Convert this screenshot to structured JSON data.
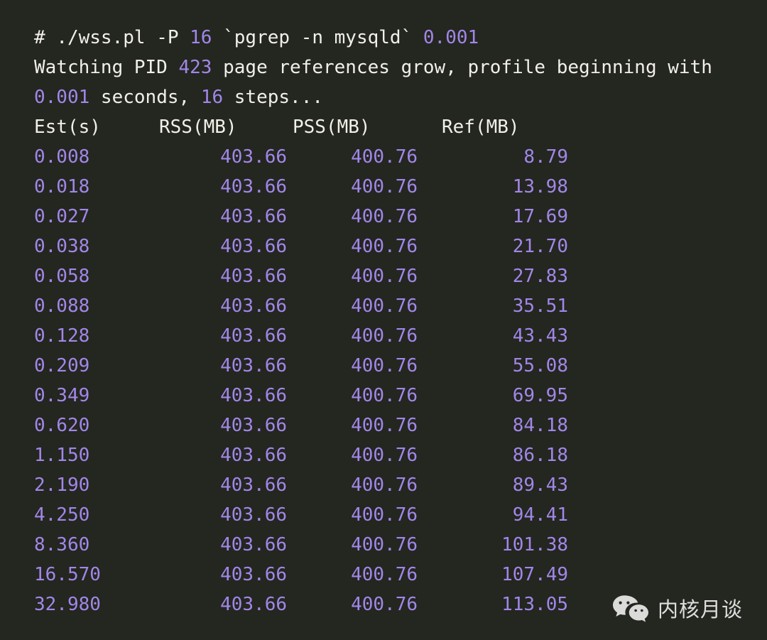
{
  "terminal": {
    "background_color": "#242620",
    "text_color": "#f1f0e8",
    "number_color": "#a187e8",
    "command_line": {
      "prompt": "# ",
      "command_part1": "./wss.pl -P ",
      "arg_parallel": "16",
      "command_part2": " `pgrep -n mysqld` ",
      "arg_interval": "0.001"
    },
    "status_line": {
      "part1": "Watching PID ",
      "pid": "423",
      "part2": " page references grow, profile beginning with",
      "part3_interval": "0.001",
      "part4": " seconds, ",
      "part5_steps": "16",
      "part6": " steps..."
    }
  },
  "table": {
    "headers": [
      "Est(s)",
      "RSS(MB)",
      "PSS(MB)",
      "Ref(MB)"
    ],
    "rows": [
      [
        "0.008",
        "403.66",
        "400.76",
        "8.79"
      ],
      [
        "0.018",
        "403.66",
        "400.76",
        "13.98"
      ],
      [
        "0.027",
        "403.66",
        "400.76",
        "17.69"
      ],
      [
        "0.038",
        "403.66",
        "400.76",
        "21.70"
      ],
      [
        "0.058",
        "403.66",
        "400.76",
        "27.83"
      ],
      [
        "0.088",
        "403.66",
        "400.76",
        "35.51"
      ],
      [
        "0.128",
        "403.66",
        "400.76",
        "43.43"
      ],
      [
        "0.209",
        "403.66",
        "400.76",
        "55.08"
      ],
      [
        "0.349",
        "403.66",
        "400.76",
        "69.95"
      ],
      [
        "0.620",
        "403.66",
        "400.76",
        "84.18"
      ],
      [
        "1.150",
        "403.66",
        "400.76",
        "86.18"
      ],
      [
        "2.190",
        "403.66",
        "400.76",
        "89.43"
      ],
      [
        "4.250",
        "403.66",
        "400.76",
        "94.41"
      ],
      [
        "8.360",
        "403.66",
        "400.76",
        "101.38"
      ],
      [
        "16.570",
        "403.66",
        "400.76",
        "107.49"
      ],
      [
        "32.980",
        "403.66",
        "400.76",
        "113.05"
      ]
    ]
  },
  "watermark": {
    "icon": "wechat-logo-icon",
    "text": "内核月谈"
  }
}
